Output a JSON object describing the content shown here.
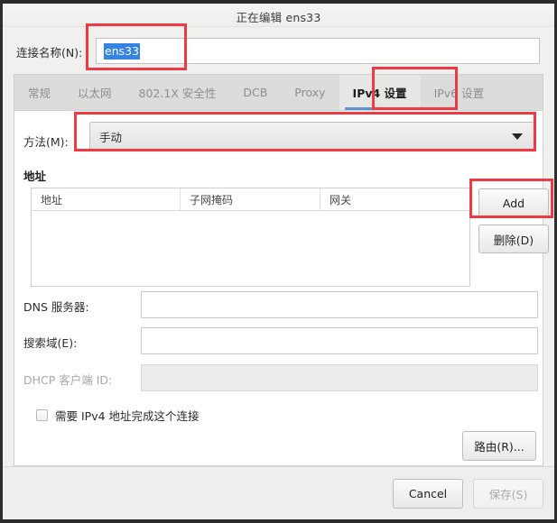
{
  "window": {
    "title": "正在编辑 ens33"
  },
  "connection": {
    "name_label": "连接名称(N):",
    "name_value": "ens33"
  },
  "tabs": [
    {
      "label": "常规",
      "active": false
    },
    {
      "label": "以太网",
      "active": false
    },
    {
      "label": "802.1X 安全性",
      "active": false
    },
    {
      "label": "DCB",
      "active": false
    },
    {
      "label": "Proxy",
      "active": false
    },
    {
      "label": "IPv4 设置",
      "active": true
    },
    {
      "label": "IPv6 设置",
      "active": false
    }
  ],
  "ipv4": {
    "method_label": "方法(M):",
    "method_value": "手动",
    "address_section_title": "地址",
    "address_columns": [
      "地址",
      "子网掩码",
      "网关"
    ],
    "address_rows": [],
    "add_button": "Add",
    "delete_button": "删除(D)",
    "dns_label": "DNS 服务器:",
    "dns_value": "",
    "dns_placeholder": "",
    "search_label": "搜索域(E):",
    "search_value": "",
    "search_placeholder": "",
    "dhcp_label": "DHCP 客户端 ID:",
    "dhcp_value": "",
    "dhcp_placeholder": "",
    "require_checkbox_label": "需要 IPv4 地址完成这个连接",
    "require_checkbox_checked": false,
    "routes_button": "路由(R)..."
  },
  "footer": {
    "cancel_button": "Cancel",
    "save_button": "保存(S)",
    "save_disabled": true
  },
  "annotations": {
    "highlight_color": "#ee3b43",
    "boxes": [
      "connection-name",
      "ipv4-tab",
      "method-combo",
      "add-button"
    ]
  },
  "colors": {
    "accent_tab_underline": "#5e93cf",
    "selection_blue": "#3584e4",
    "dialog_bg": "#f0f0ef",
    "panel_bg": "#ffffff"
  }
}
